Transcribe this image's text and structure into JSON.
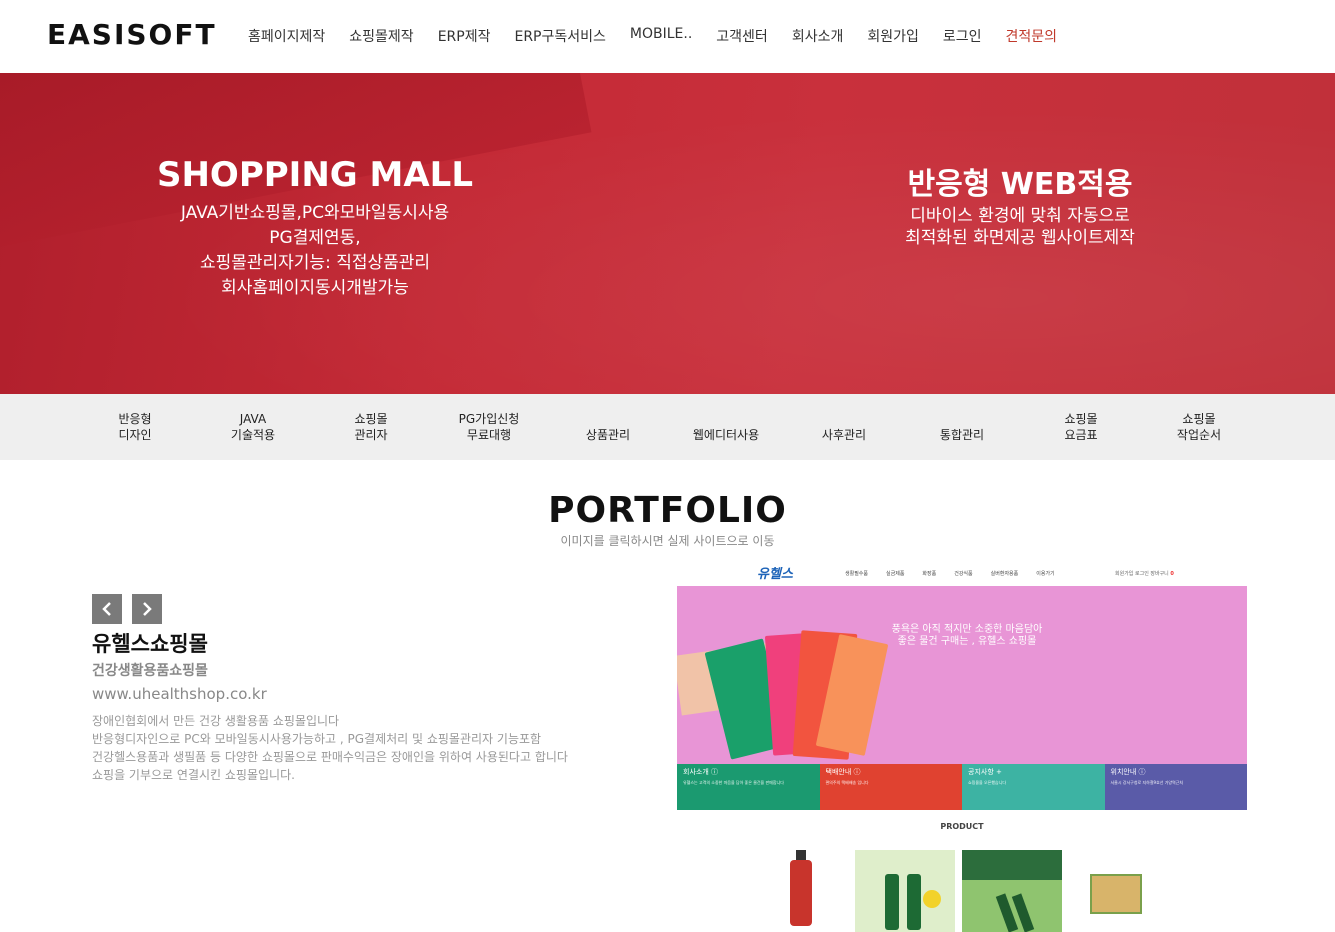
{
  "header": {
    "logo": "EASISOFT",
    "nav": [
      "홈페이지제작",
      "쇼핑몰제작",
      "ERP제작",
      "ERP구독서비스",
      "MOBILE..",
      "고객센터",
      "회사소개",
      "회원가입",
      "로그인",
      "견적문의"
    ]
  },
  "hero": {
    "left_title": "SHOPPING MALL",
    "left_lines": [
      "JAVA기반쇼핑몰,PC와모바일동시사용",
      "PG결제연동,",
      "쇼핑몰관리자기능: 직접상품관리",
      "회사홈페이지동시개발가능"
    ],
    "right_title": "반응형 WEB적용",
    "right_lines": [
      "디바이스 환경에 맞춰 자동으로",
      "최적화된 화면제공 웹사이트제작"
    ]
  },
  "features": [
    [
      "반응형",
      "디자인"
    ],
    [
      "JAVA",
      "기술적용"
    ],
    [
      "쇼핑몰",
      "관리자"
    ],
    [
      "PG가입신청",
      "무료대행"
    ],
    [
      "상품관리"
    ],
    [
      "웹에디터사용"
    ],
    [
      "사후관리"
    ],
    [
      "통합관리"
    ],
    [
      "쇼핑몰",
      "요금표"
    ],
    [
      "쇼핑몰",
      "작업순서"
    ]
  ],
  "portfolio": {
    "title": "PORTFOLIO",
    "subtitle": "이미지를 클릭하시면 실제 사이트으로 이동",
    "prev_icon": "chevron-left-icon",
    "next_icon": "chevron-right-icon",
    "site_name": "유헬스쇼핑몰",
    "site_category": "건강생활용품쇼핑몰",
    "site_url": "www.uhealthshop.co.kr",
    "description": [
      "장애인협회에서 만든 건강 생활용품 쇼핑몰입니다",
      "반응형디자인으로 PC와 모바일동시사용가능하고 , PG결제처리 및 쇼핑몰관리자 기능포함",
      "건강헬스용품과  생필품 등 다양한 쇼핑몰으로 판매수익금은 장애인을 위하여 사용된다고 합니다",
      "쇼핑을 기부으로 연결시킨 쇼핑몰입니다."
    ]
  },
  "preview": {
    "logo": "유헬스",
    "menu": [
      "생활필수품",
      "실금제품",
      "화장품",
      "건강식품",
      "실버환자용품",
      "이용가기"
    ],
    "util": "회원가입  로그인  장바구니",
    "util_count": "0",
    "banner_lines": [
      "풍욕은 아직 적지만 소중한 마음담아",
      "좋은 물건 구매는 , 유헬스 쇼핑몰"
    ],
    "tiles": [
      {
        "title": "회사소개 ⓘ",
        "text": "유헬스는 고객의 소중한 마음을 담아 좋은 물건을 판매합니다",
        "color": "#1b9a70"
      },
      {
        "title": "택배안내 ⓘ",
        "text": "편의주의 택배배송 입니다",
        "color": "#e04230"
      },
      {
        "title": "공지사항 +",
        "text": "쇼핑몰을 오픈했습니다",
        "color": "#3db3a3"
      },
      {
        "title": "위치안내 ⓘ",
        "text": "서울시 강서구청로 지하철9호선 가양역근처",
        "color": "#5a5ba8"
      }
    ],
    "product_label": "PRODUCT",
    "colors": {
      "banner": "#e895d6",
      "logo": "#1d63b8"
    }
  },
  "colors": {
    "hero_red": "#c42a36",
    "accent": "#c0392b",
    "feature_bg": "#efefef"
  }
}
